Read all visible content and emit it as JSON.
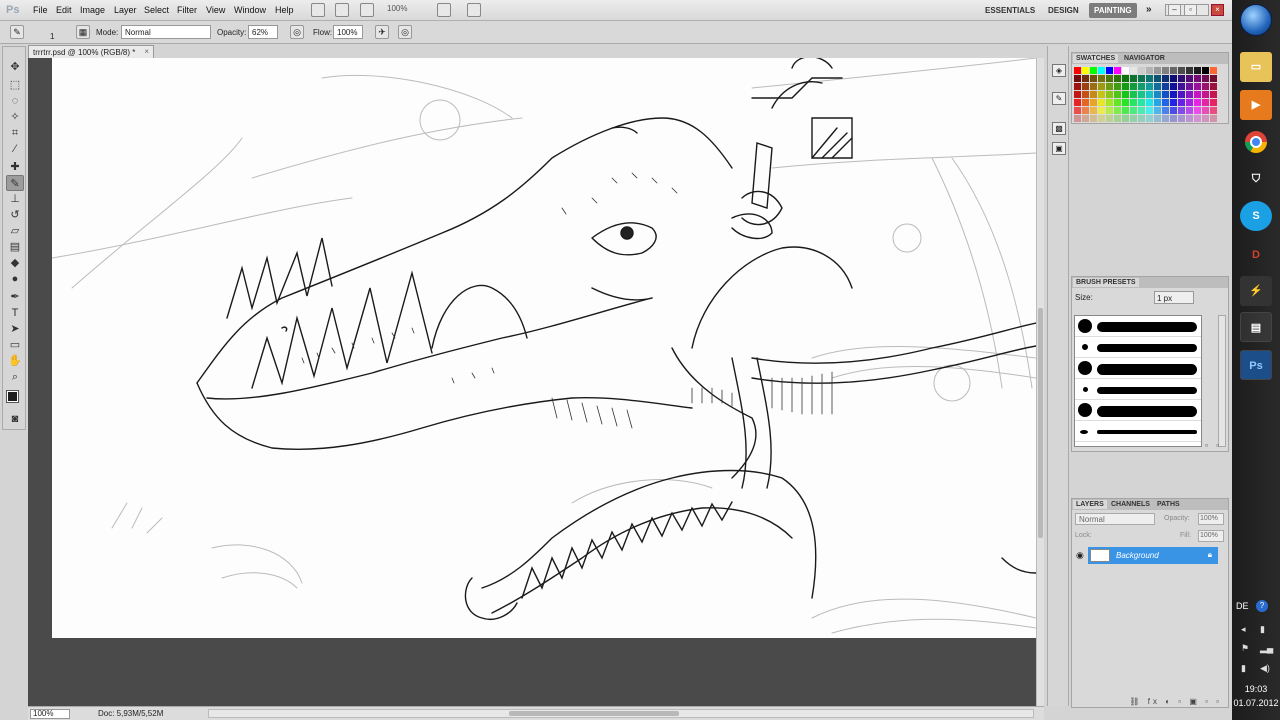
{
  "app": {
    "logo": "Ps"
  },
  "menu": [
    "File",
    "Edit",
    "Image",
    "Layer",
    "Select",
    "Filter",
    "View",
    "Window",
    "Help"
  ],
  "zoom_menu": "100%",
  "workspaces": {
    "essentials": "ESSENTIALS",
    "design": "DESIGN",
    "painting": "PAINTING",
    "more": "»"
  },
  "options": {
    "brush_size": "1",
    "mode_label": "Mode:",
    "mode_value": "Normal",
    "opacity_label": "Opacity:",
    "opacity_value": "62%",
    "flow_label": "Flow:",
    "flow_value": "100%"
  },
  "document": {
    "tab_title": "trrrtrr.psd @ 100% (RGB/8) *",
    "close": "×"
  },
  "status": {
    "zoom": "100%",
    "doc": "Doc: 5,93M/5,52M"
  },
  "panels": {
    "swatches": {
      "tabs": [
        "SWATCHES",
        "NAVIGATOR"
      ]
    },
    "brush_presets": {
      "title": "BRUSH PRESETS",
      "size_label": "Size:",
      "size_value": "1 px"
    },
    "layers": {
      "tabs": [
        "LAYERS",
        "CHANNELS",
        "PATHS"
      ],
      "blend_mode": "Normal",
      "opacity_label": "Opacity:",
      "opacity_value": "100%",
      "lock_label": "Lock:",
      "fill_label": "Fill:",
      "fill_value": "100%",
      "layer_name": "Background"
    }
  },
  "taskbar": {
    "language": "DE",
    "photoshop_label": "Ps",
    "time": "19:03",
    "date": "01.07.2012"
  },
  "colors": {
    "foreground": "#1e1e1e",
    "background": "#ffffff",
    "selection": "#3a94e6",
    "swatches": [
      "#ff0000",
      "#ffff00",
      "#00ff00",
      "#00ffff",
      "#0000ff",
      "#ff00ff",
      "#ffffff",
      "#e6e6e6",
      "#cccccc",
      "#b3b3b3",
      "#999999",
      "#808080",
      "#666666",
      "#4d4d4d",
      "#333333",
      "#1a1a1a",
      "#000000",
      "#ff6633"
    ]
  }
}
